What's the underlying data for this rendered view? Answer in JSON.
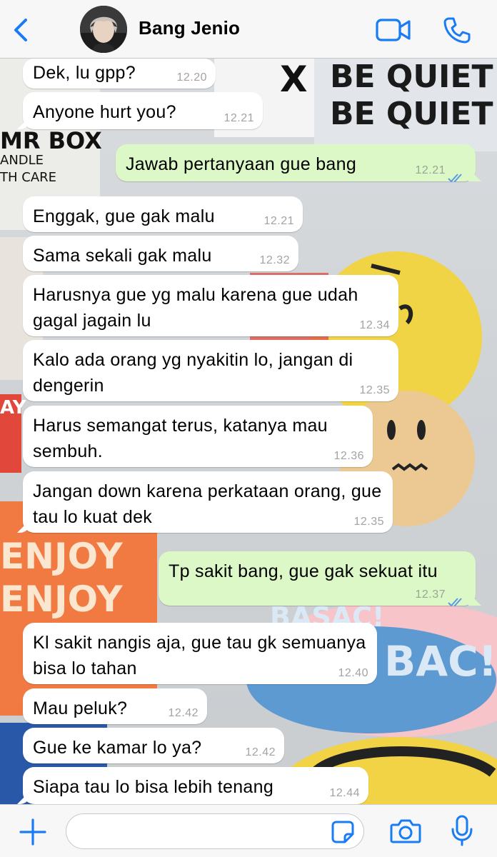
{
  "header": {
    "back_icon": "chevron-left-icon",
    "contact_name": "Bang Jenio",
    "video_icon": "video-camera-icon",
    "call_icon": "phone-icon",
    "accent_color": "#1a7cf5"
  },
  "wallpaper": {
    "texts": [
      "BE QUIET",
      "BE QUIET",
      "MR BOX",
      "ANDLE",
      "TH CARE",
      "ENJOY",
      "ENJOY",
      "BASAC!",
      "BAC!",
      "AY",
      "X"
    ]
  },
  "messages": [
    {
      "dir": "in",
      "text": "Dek, lu gpp?",
      "time": "12.20"
    },
    {
      "dir": "in",
      "text": "Anyone hurt you?",
      "time": "12.21"
    },
    {
      "dir": "out",
      "text": "Jawab pertanyaan gue bang",
      "time": "12.21",
      "status": "read"
    },
    {
      "dir": "in",
      "text": "Enggak, gue gak malu",
      "time": "12.21"
    },
    {
      "dir": "in",
      "text": "Sama sekali gak malu",
      "time": "12.32"
    },
    {
      "dir": "in",
      "text": "Harusnya gue yg malu karena gue udah gagal jagain lu",
      "time": "12.34"
    },
    {
      "dir": "in",
      "text": "Kalo ada orang yg nyakitin lo, jangan di dengerin",
      "time": "12.35"
    },
    {
      "dir": "in",
      "text": "Harus semangat terus, katanya mau sembuh.",
      "time": "12.36"
    },
    {
      "dir": "in",
      "text": "Jangan down karena perkataan orang, gue tau lo kuat dek",
      "time": "12.35"
    },
    {
      "dir": "out",
      "text": "Tp sakit bang, gue gak sekuat itu",
      "time": "12.37",
      "status": "read"
    },
    {
      "dir": "in",
      "text": "Kl sakit nangis aja, gue tau gk semuanya bisa lo tahan",
      "time": "12.40"
    },
    {
      "dir": "in",
      "text": "Mau peluk?",
      "time": "12.42"
    },
    {
      "dir": "in",
      "text": "Gue ke kamar lo ya?",
      "time": "12.42"
    },
    {
      "dir": "in",
      "text": "Siapa tau lo bisa lebih tenang",
      "time": "12.44"
    }
  ],
  "footer": {
    "plus_icon": "plus-icon",
    "message_input_value": "",
    "sticker_icon": "sticker-icon",
    "camera_icon": "camera-icon",
    "mic_icon": "microphone-icon"
  }
}
